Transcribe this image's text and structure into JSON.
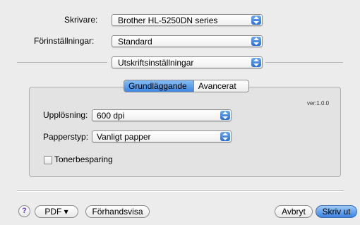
{
  "printer": {
    "label": "Skrivare:",
    "value": "Brother HL-5250DN series"
  },
  "presets": {
    "label": "Förinställningar:",
    "value": "Standard"
  },
  "section": {
    "value": "Utskriftsinställningar"
  },
  "tabs": [
    {
      "label": "Grundläggande",
      "selected": true
    },
    {
      "label": "Avancerat",
      "selected": false
    }
  ],
  "version": "ver:1.0.0",
  "resolution": {
    "label": "Upplösning:",
    "value": "600 dpi"
  },
  "paper_type": {
    "label": "Papperstyp:",
    "value": "Vanligt papper"
  },
  "toner_saving": {
    "label": "Tonerbesparing",
    "checked": false
  },
  "footer": {
    "help": "?",
    "pdf": "PDF ▾",
    "preview": "Förhandsvisa",
    "cancel": "Avbryt",
    "print": "Skriv ut"
  },
  "colors": {
    "accent": "#3f86e3"
  }
}
